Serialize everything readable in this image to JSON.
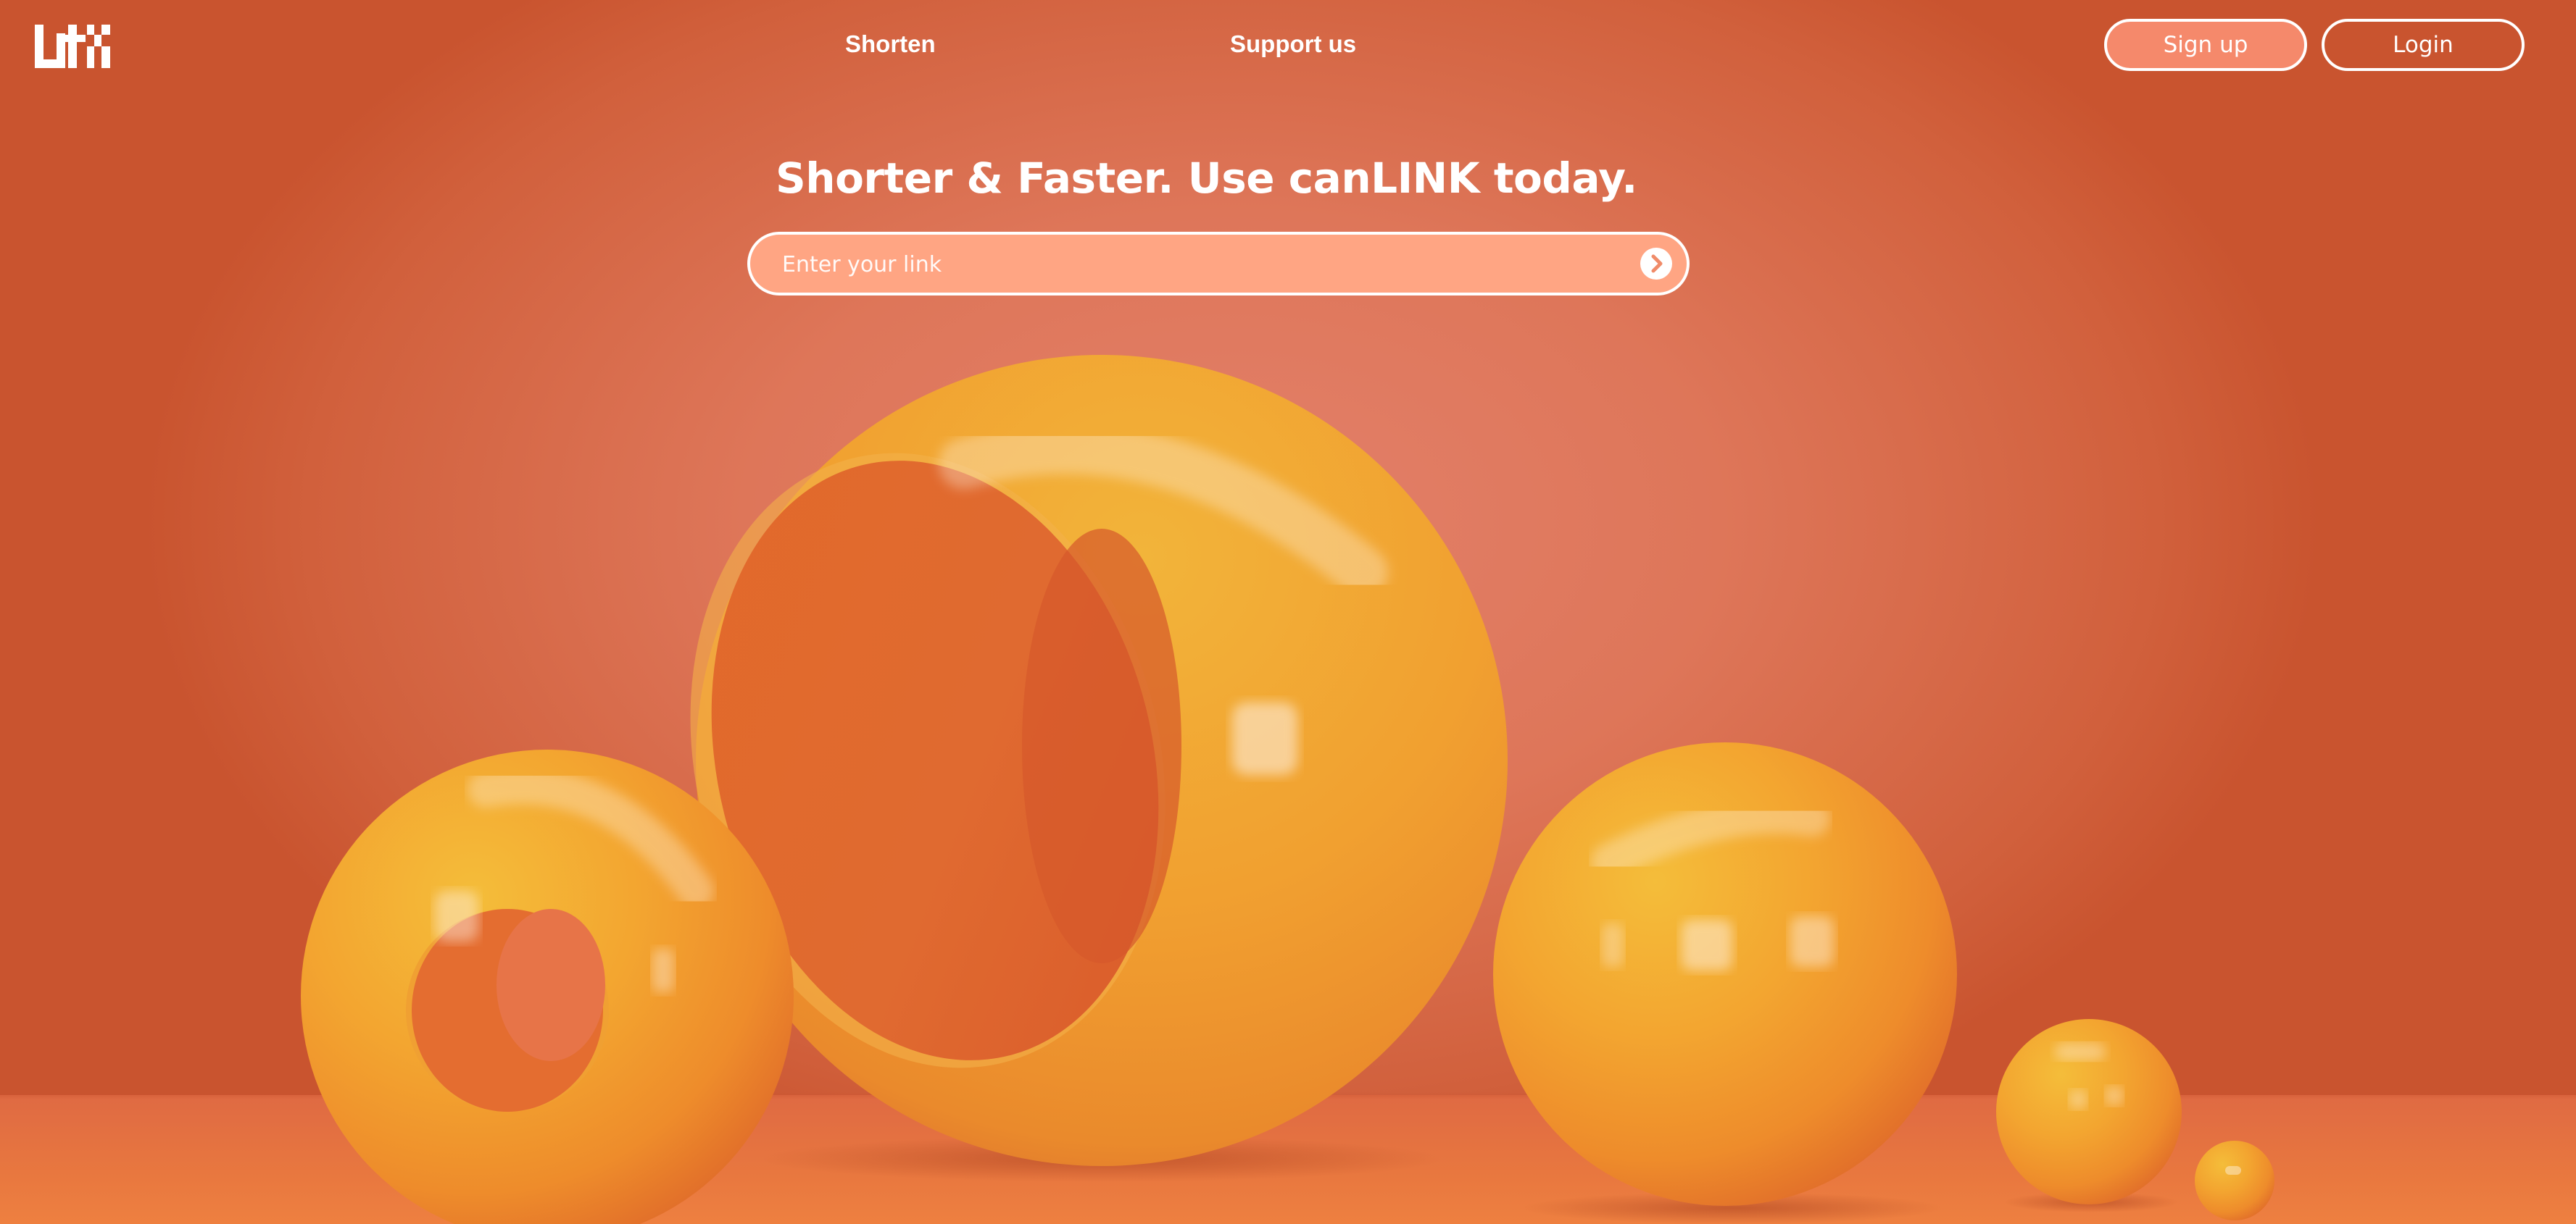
{
  "header": {
    "logo_alt": "Lirk logo",
    "nav": [
      {
        "label": "Shorten"
      },
      {
        "label": "Support us"
      }
    ],
    "signup_label": "Sign up",
    "login_label": "Login"
  },
  "hero": {
    "headline": "Shorter & Faster. Use canLINK today.",
    "input": {
      "placeholder": "Enter your link",
      "value": ""
    },
    "submit_icon": "arrow-right-circle-icon"
  },
  "colors": {
    "background": "#d9694a",
    "sphere": "#f5a52a",
    "input_fill": "#ffa583",
    "signup_fill": "#f5896b",
    "text": "#ffffff"
  }
}
